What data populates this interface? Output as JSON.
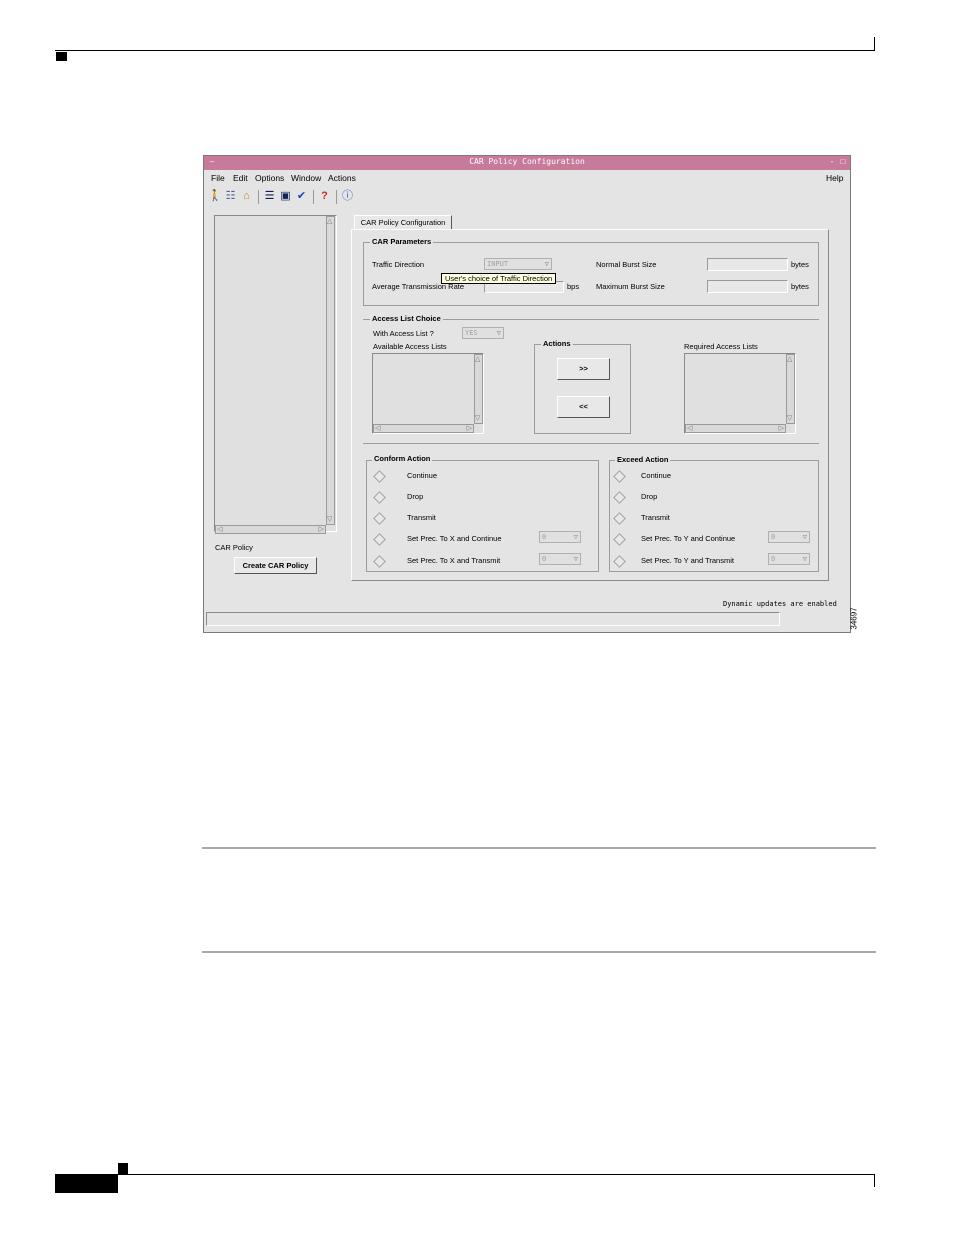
{
  "window": {
    "title": "CAR Policy Configuration",
    "sys_icon": "–",
    "minimize": "-",
    "maximize": "□"
  },
  "menu": {
    "file": "File",
    "edit": "Edit",
    "options": "Options",
    "window": "Window",
    "actions": "Actions",
    "help": "Help"
  },
  "toolbar": {
    "icons": [
      "exit-icon",
      "network-icon",
      "folder-icon",
      "list-icon",
      "monitor-icon",
      "check-icon",
      "help-icon",
      "info-icon"
    ]
  },
  "left_panel": {
    "label": "CAR Policy",
    "create_button": "Create CAR Policy"
  },
  "tab": {
    "label": "CAR Policy Configuration"
  },
  "car_params": {
    "title": "CAR Parameters",
    "traffic_direction_label": "Traffic Direction",
    "traffic_direction_value": "INPUT",
    "avg_rate_label": "Average Transmission Rate",
    "avg_rate_unit": "bps",
    "normal_burst_label": "Normal Burst Size",
    "normal_burst_unit": "bytes",
    "max_burst_label": "Maximum Burst Size",
    "max_burst_unit": "bytes",
    "tooltip": "User's choice of Traffic Direction"
  },
  "access_list": {
    "title": "Access List Choice",
    "with_label": "With Access List ?",
    "with_value": "YES",
    "available_label": "Available Access Lists",
    "actions_title": "Actions",
    "add_button": ">>",
    "remove_button": "<<",
    "required_label": "Required Access Lists"
  },
  "conform": {
    "title": "Conform Action",
    "continue": "Continue",
    "drop": "Drop",
    "transmit": "Transmit",
    "set_continue": "Set Prec. To X and Continue",
    "set_continue_value": "0",
    "set_transmit": "Set Prec. To X and Transmit",
    "set_transmit_value": "0"
  },
  "exceed": {
    "title": "Exceed Action",
    "continue": "Continue",
    "drop": "Drop",
    "transmit": "Transmit",
    "set_continue": "Set Prec. To Y and Continue",
    "set_continue_value": "0",
    "set_transmit": "Set Prec. To Y and Transmit",
    "set_transmit_value": "0"
  },
  "status": {
    "text": "Dynamic updates are enabled"
  },
  "figure_id": "34697",
  "colors": {
    "titlebar": "#c77a9a",
    "window_bg": "#e4e4e4"
  }
}
